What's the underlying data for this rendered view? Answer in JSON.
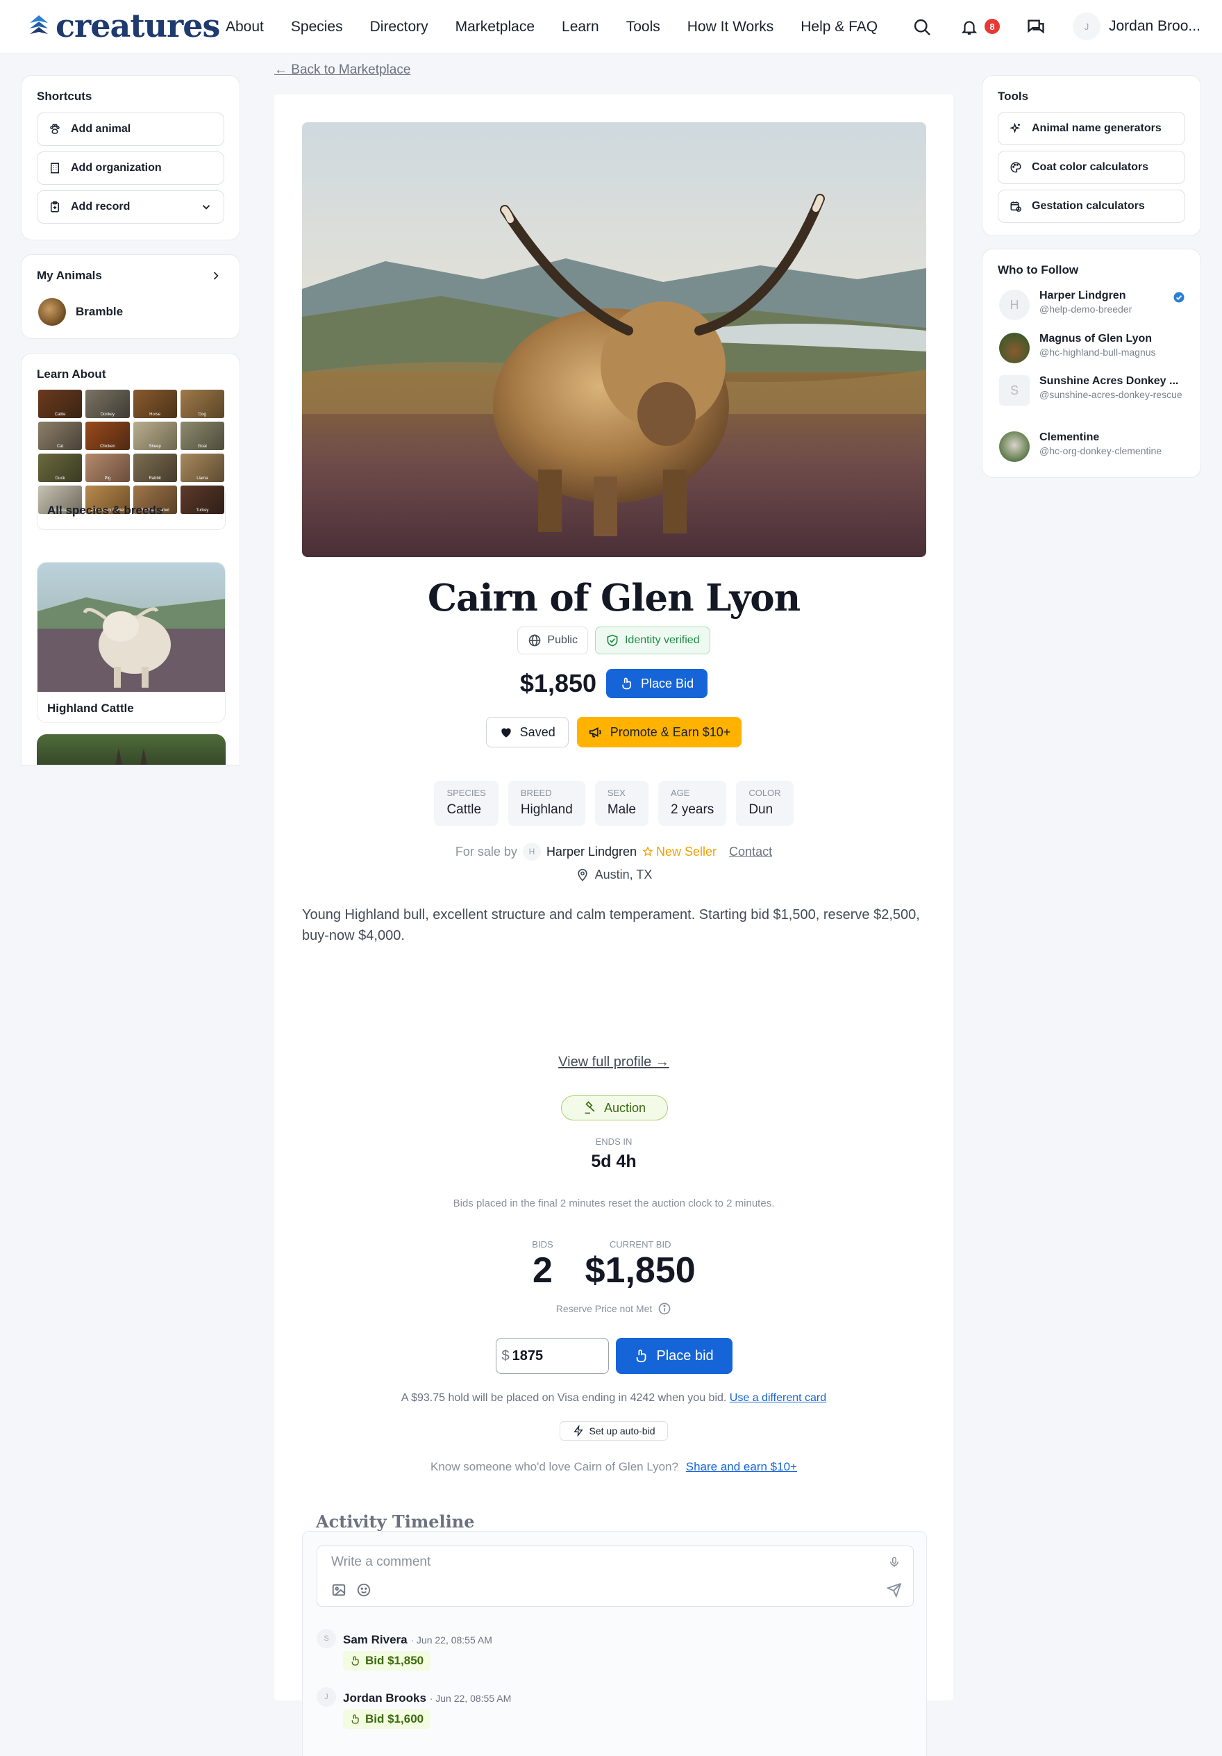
{
  "brand": {
    "name": "creatures"
  },
  "nav": {
    "items": [
      "About",
      "Species",
      "Directory",
      "Marketplace",
      "Learn",
      "Tools",
      "How It Works",
      "Help & FAQ"
    ],
    "notification_count": "8",
    "user_name": "Jordan Broo...",
    "user_initial": "J"
  },
  "left": {
    "shortcuts": {
      "title": "Shortcuts",
      "items": [
        "Add animal",
        "Add organization",
        "Add record"
      ]
    },
    "my_animals": {
      "title": "My Animals",
      "items": [
        "Bramble"
      ]
    },
    "learn_about": {
      "title": "Learn About",
      "species": [
        "Cattle",
        "Donkey",
        "Horse",
        "Dog",
        "Cat",
        "Chicken",
        "Sheep",
        "Goat",
        "Duck",
        "Pig",
        "Rabbit",
        "Llama",
        "Alpaca",
        "Dromedary Camel",
        "Bactrian Camel",
        "Turkey"
      ],
      "all_label": "All species & breeds",
      "featured": [
        "Highland Cattle"
      ]
    }
  },
  "listing": {
    "back_label": "← Back to Marketplace",
    "title": "Cairn of Glen Lyon",
    "visibility": "Public",
    "verified": "Identity verified",
    "price": "$1,850",
    "place_bid_label": "Place Bid",
    "saved_label": "Saved",
    "promote_label": "Promote & Earn $10+",
    "attributes": [
      {
        "label": "Species",
        "value": "Cattle"
      },
      {
        "label": "Breed",
        "value": "Highland"
      },
      {
        "label": "Sex",
        "value": "Male"
      },
      {
        "label": "Age",
        "value": "2 years"
      },
      {
        "label": "Color",
        "value": "Dun"
      }
    ],
    "seller": {
      "prefix": "For sale by",
      "initial": "H",
      "name": "Harper Lindgren",
      "badge": "New Seller",
      "contact": "Contact",
      "location": "Austin, TX"
    },
    "description": "Young Highland bull, excellent structure and calm temperament. Starting bid $1,500, reserve $2,500, buy-now $4,000.",
    "view_profile": "View full profile →",
    "auction": {
      "label": "Auction",
      "ends_label": "Ends in",
      "ends_value": "5d 4h",
      "note": "Bids placed in the final 2 minutes reset the auction clock to 2 minutes.",
      "bids_label": "Bids",
      "bids_value": "2",
      "current_label": "Current bid",
      "current_value": "$1,850",
      "reserve": "Reserve Price not Met",
      "currency": "$",
      "bid_amount": "1875",
      "bid_button": "Place bid",
      "hold_note": "A $93.75 hold will be placed on Visa ending in 4242 when you bid.",
      "hold_link": "Use a different card",
      "autobid": "Set up auto-bid",
      "share_prompt": "Know someone who'd love Cairn of Glen Lyon?",
      "share_link": "Share and earn $10+"
    }
  },
  "timeline": {
    "title": "Activity Timeline",
    "placeholder": "Write a comment",
    "items": [
      {
        "initial": "S",
        "name": "Sam Rivera",
        "time": "· Jun 22, 08:55 AM",
        "bid": "Bid $1,850"
      },
      {
        "initial": "J",
        "name": "Jordan Brooks",
        "time": "· Jun 22, 08:55 AM",
        "bid": "Bid $1,600"
      }
    ]
  },
  "right": {
    "tools": {
      "title": "Tools",
      "items": [
        "Animal name generators",
        "Coat color calculators",
        "Gestation calculators"
      ]
    },
    "follow": {
      "title": "Who to Follow",
      "items": [
        {
          "initial": "H",
          "name": "Harper Lindgren",
          "handle": "@help-demo-breeder"
        },
        {
          "initial": "",
          "name": "Magnus of Glen Lyon",
          "handle": "@hc-highland-bull-magnus"
        },
        {
          "initial": "S",
          "name": "Sunshine Acres Donkey ...",
          "handle": "@sunshine-acres-donkey-rescue"
        },
        {
          "initial": "",
          "name": "Clementine",
          "handle": "@hc-org-donkey-clementine"
        }
      ]
    }
  },
  "colors": {
    "accent": "#1565d8",
    "brand": "#1e3a6e",
    "promote": "#ffb300",
    "verified": "#1f8a45",
    "auction": "#3c6a10"
  }
}
